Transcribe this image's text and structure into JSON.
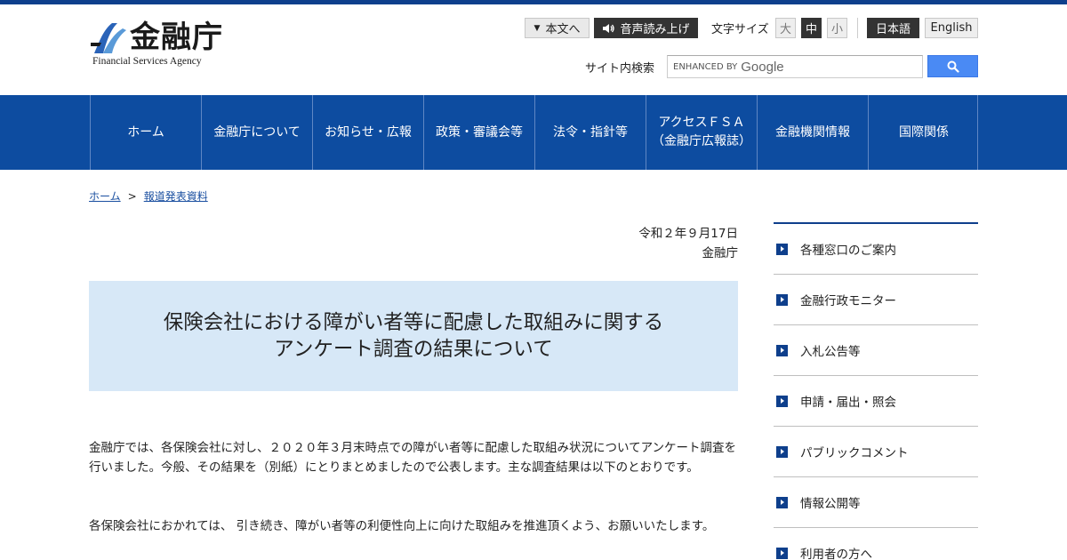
{
  "header": {
    "logo_title": "金融庁",
    "logo_subtitle": "Financial Services Agency",
    "skip_label": "本文へ",
    "voice_label": "音声読み上げ",
    "font_size_label": "文字サイズ",
    "font_sizes": [
      "大",
      "中",
      "小"
    ],
    "font_size_selected": "中",
    "lang_ja": "日本語",
    "lang_en": "English",
    "search_label": "サイト内検索",
    "search_enhanced": "ENHANCED BY",
    "search_google": "Google"
  },
  "nav": {
    "items": [
      {
        "label": "ホーム"
      },
      {
        "label": "金融庁について"
      },
      {
        "label": "お知らせ・広報"
      },
      {
        "label": "政策・審議会等"
      },
      {
        "label": "法令・指針等"
      },
      {
        "label_line1": "アクセスＦＳＡ",
        "label_line2": "（金融庁広報誌）"
      },
      {
        "label": "金融機関情報"
      },
      {
        "label": "国際関係"
      }
    ]
  },
  "breadcrumb": {
    "home": "ホーム",
    "separator": ">",
    "current": "報道発表資料"
  },
  "article": {
    "date": "令和２年９月17日",
    "publisher": "金融庁",
    "title_line1": "保険会社における障がい者等に配慮した取組みに関する",
    "title_line2": "アンケート調査の結果について",
    "paragraph1": "金融庁では、各保険会社に対し、２０２０年３月末時点での障がい者等に配慮した取組み状況についてアンケート調査を行いました。今般、その結果を（別紙）にとりまとめましたので公表します。主な調査結果は以下のとおりです。",
    "paragraph2": "各保険会社におかれては、 引き続き、障がい者等の利便性向上に向けた取組みを推進頂くよう、お願いいたします。"
  },
  "sidebar": {
    "items": [
      {
        "label": "各種窓口のご案内"
      },
      {
        "label": "金融行政モニター"
      },
      {
        "label": "入札公告等"
      },
      {
        "label": "申請・届出・照会"
      },
      {
        "label": "パブリックコメント"
      },
      {
        "label": "情報公開等"
      },
      {
        "label": "利用者の方へ"
      }
    ]
  },
  "colors": {
    "brand_dark": "#0e3f8c",
    "nav_bg": "#0d4ca0",
    "title_bg": "#d7e8f7",
    "search_button": "#4a8af4"
  }
}
